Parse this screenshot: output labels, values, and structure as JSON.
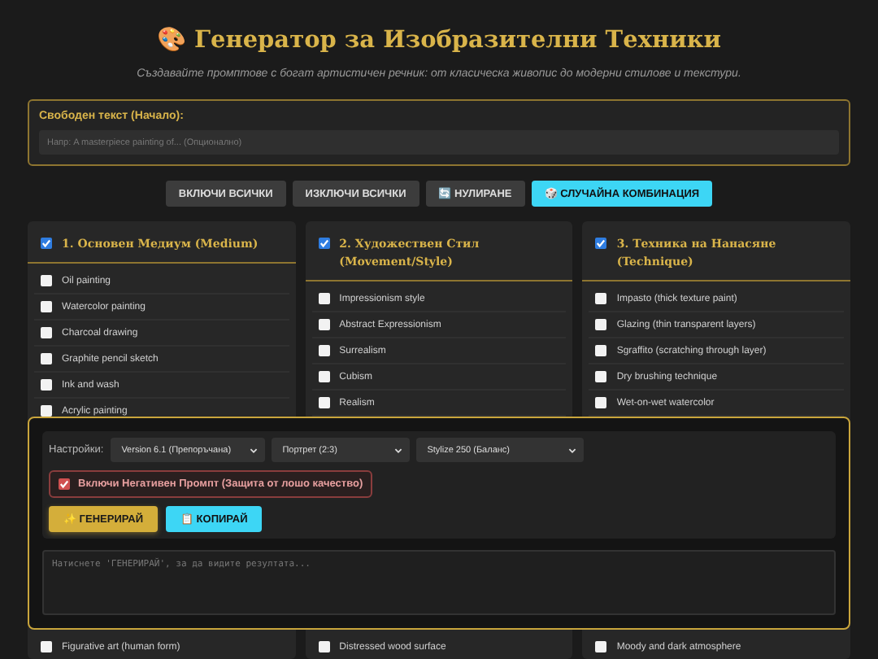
{
  "header": {
    "icon": "🎨",
    "title": "Генератор за Изобразителни Техники",
    "subtitle": "Създавайте промптове с богат артистичен речник: от класическа живопис до модерни стилове и текстури."
  },
  "free_text": {
    "label": "Свободен текст (Начало):",
    "placeholder": "Напр: A masterpiece painting of... (Опционално)"
  },
  "actions": [
    {
      "label": "ВКЛЮЧИ ВСИЧКИ",
      "kind": "plain"
    },
    {
      "label": "ИЗКЛЮЧИ ВСИЧКИ",
      "kind": "plain"
    },
    {
      "label": "🔄 НУЛИРАНЕ",
      "kind": "plain"
    },
    {
      "label": "🎲 СЛУЧАЙНА КОМБИНАЦИЯ",
      "kind": "accent"
    }
  ],
  "categories": [
    {
      "title": "1. Основен Медиум (Medium)",
      "checked": true,
      "items": [
        {
          "label": "Oil painting",
          "checked": false
        },
        {
          "label": "Watercolor painting",
          "checked": false
        },
        {
          "label": "Charcoal drawing",
          "checked": false
        },
        {
          "label": "Graphite pencil sketch",
          "checked": false
        },
        {
          "label": "Ink and wash",
          "checked": false
        },
        {
          "label": "Acrylic painting",
          "checked": false
        }
      ],
      "tail_items": [
        {
          "label": "Figurative art (human form)",
          "checked": false
        }
      ]
    },
    {
      "title": "2. Художествен Стил (Movement/Style)",
      "checked": true,
      "items": [
        {
          "label": "Impressionism style",
          "checked": false
        },
        {
          "label": "Abstract Expressionism",
          "checked": false
        },
        {
          "label": "Surrealism",
          "checked": false
        },
        {
          "label": "Cubism",
          "checked": false
        },
        {
          "label": "Realism",
          "checked": false
        }
      ],
      "tail_items": [
        {
          "label": "Distressed wood surface",
          "checked": false
        }
      ]
    },
    {
      "title": "3. Техника на Нанасяне (Technique)",
      "checked": true,
      "items": [
        {
          "label": "Impasto (thick texture paint)",
          "checked": false
        },
        {
          "label": "Glazing (thin transparent layers)",
          "checked": false
        },
        {
          "label": "Sgraffito (scratching through layer)",
          "checked": false
        },
        {
          "label": "Dry brushing technique",
          "checked": false
        },
        {
          "label": "Wet-on-wet watercolor",
          "checked": false
        }
      ],
      "tail_items": [
        {
          "label": "Moody and dark atmosphere",
          "checked": false
        }
      ]
    }
  ],
  "panel": {
    "settings_label": "Настройки:",
    "selects": [
      {
        "value": "Version 6.1 (Препоръчана)"
      },
      {
        "value": "Портрет (2:3)"
      },
      {
        "value": "Stylize 250 (Баланс)"
      }
    ],
    "negative": {
      "label": "Включи Негативен Промпт (Защита от лошо качество)",
      "checked": true
    },
    "buttons": [
      {
        "label": "✨ ГЕНЕРИРАЙ",
        "kind": "gold"
      },
      {
        "label": "📋 КОПИРАЙ",
        "kind": "accent"
      }
    ],
    "output": {
      "placeholder": "Натиснете 'ГЕНЕРИРАЙ', за да видите резултата..."
    }
  }
}
